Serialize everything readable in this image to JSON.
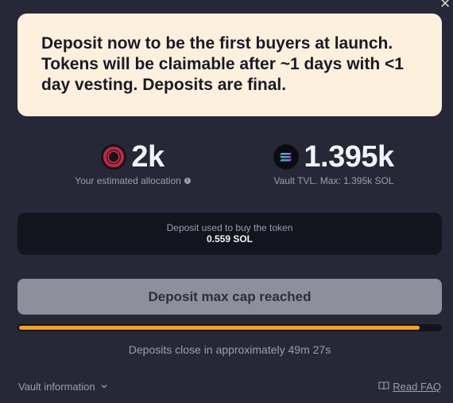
{
  "notice": {
    "text": "Deposit now to be the first buyers at launch. Tokens will be claimable after ~1 days with <1 day vesting. Deposits are final."
  },
  "stats": {
    "allocation": {
      "value": "2k",
      "label": "Your estimated allocation",
      "icon": "token-icon"
    },
    "vault": {
      "value": "1.395k",
      "label": "Vault TVL. Max: 1.395k SOL",
      "icon": "solana-icon"
    }
  },
  "usage": {
    "label": "Deposit used to buy the token",
    "value": "0.559 SOL"
  },
  "deposit_button": {
    "label": "Deposit max cap reached",
    "state": "disabled"
  },
  "progress": {
    "fraction": 0.95,
    "color": "#f8a01d"
  },
  "countdown": {
    "text": "Deposits close in approximately 49m 27s"
  },
  "footer": {
    "vault_info_label": "Vault information",
    "faq_label": "Read FAQ"
  },
  "colors": {
    "background": "#262837",
    "notice_bg": "#fdf1dd",
    "accent": "#f8a01d"
  }
}
